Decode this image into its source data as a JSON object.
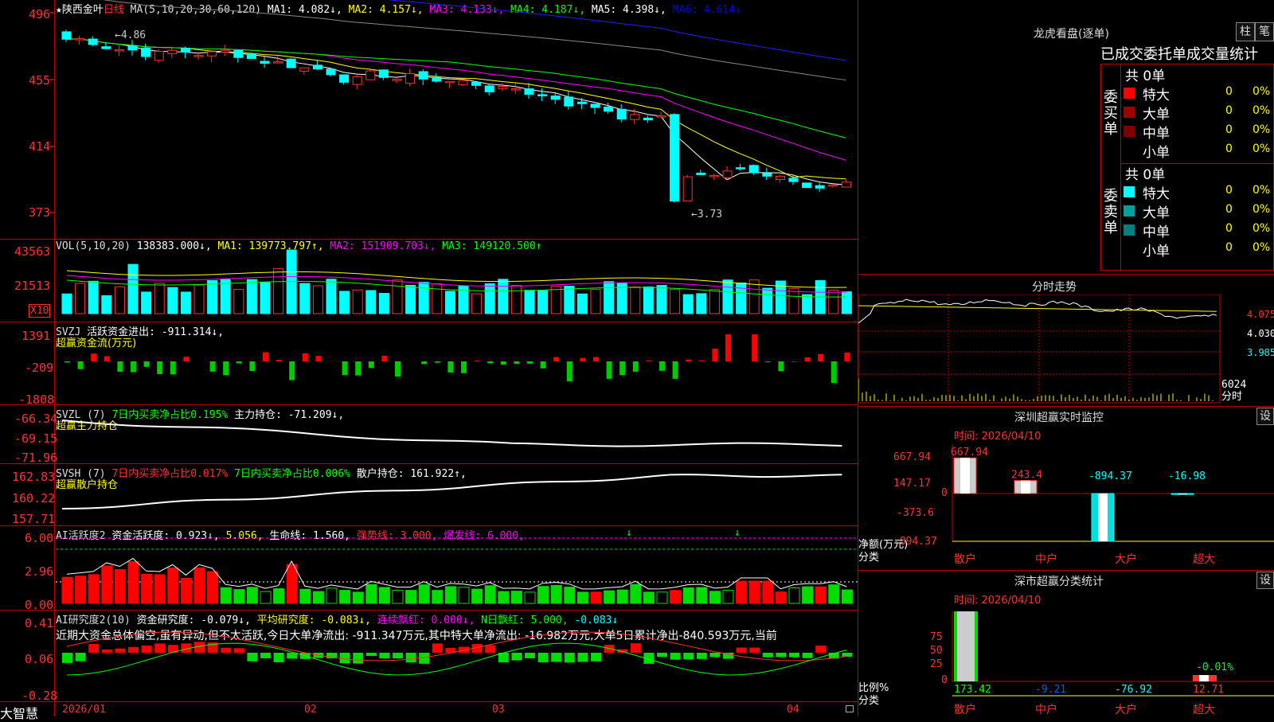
{
  "app": {
    "brand": "大智慧",
    "stock_name": "★陕西金叶",
    "period": "日线"
  },
  "main_chart": {
    "ma_text": "MA(5,10,20,30,60,120)",
    "ma1": "MA1: 4.082↓,",
    "ma2": "MA2: 4.157↓,",
    "ma3": "MA3: 4.133↓,",
    "ma4": "MA4: 4.187↓,",
    "ma5": "MA5: 4.398↓,",
    "ma6": "MA6: 4.614↓",
    "y_labels": [
      "496",
      "455",
      "414",
      "373"
    ],
    "high_marker": "←4.86",
    "low_marker": "←3.73",
    "colors": {
      "ma1": "#ffffff",
      "ma2": "#ffff00",
      "ma3": "#ff00ff",
      "ma4": "#00ff00",
      "ma5": "#ffffff",
      "ma6": "#0000ff",
      "up": "#ff3030",
      "down": "#00ffff"
    }
  },
  "vol_chart": {
    "title": "VOL(5,10,20)",
    "value": "138383.000↓,",
    "ma1": "MA1: 139773.797↑,",
    "ma2": "MA2: 151909.703↓,",
    "ma3": "MA3: 149120.500↑",
    "y_labels": [
      "43563",
      "21513"
    ],
    "unit": "X10"
  },
  "svzj": {
    "title": "SVZJ",
    "line1": "活跃资金进出: -911.314↓,",
    "line2": "超赢资金流(万元)",
    "y_labels": [
      "1391",
      "-209",
      "-1808"
    ]
  },
  "svzl": {
    "title": "SVZL (7)",
    "part1": "7日内买卖净占比0.195%",
    "part2": "主力持仓: -71.209↓,",
    "line2": "超赢主力持仓",
    "y_labels": [
      "-66.34",
      "-69.15",
      "-71.96"
    ]
  },
  "svsh": {
    "title": "SVSH (7)",
    "part1": "7日内买卖净占比0.017%",
    "part2": "7日内买卖净占比0.006%",
    "part3": "散户持仓: 161.922↑,",
    "line2": "超赢散户持仓",
    "y_labels": [
      "162.83",
      "160.22",
      "157.71"
    ]
  },
  "ai_active": {
    "title": "AI活跃度2",
    "p1": "资金活跃度: 0.923↓,",
    "p2": "5.056,",
    "p3": "生命线: 1.560,",
    "p4": "强势线: 3.000,",
    "p5": "爆发线: 6.000,",
    "y_labels": [
      "6.00",
      "2.96",
      "0.00"
    ]
  },
  "ai_research": {
    "title": "AI研究度2(10)",
    "p1": "资金研究度: -0.079↓,",
    "p2": "平均研究度: -0.083↓,",
    "p3": "连续飘红: 0.000↓,",
    "p4": "N日飘红: 5.000,",
    "p5": "-0.083↓",
    "note": "近期大资金总体偏空,虽有异动,但不太活跃,今日大单净流出: -911.347万元,其中特大单净流出: -16.982万元,大单5日累计净出-840.593万元,当前",
    "y_labels": [
      "0.41",
      "0.06",
      "-0.28"
    ]
  },
  "date_axis": [
    "2026/01",
    "02",
    "03",
    "04"
  ],
  "right_panel": {
    "dragon_title": "龙虎看盘(逐单)",
    "btn_bar": "柱",
    "btn_pen": "笔",
    "stats_title": "已成交委托单成交量统计",
    "buy": {
      "side_label": "委买单",
      "total": "共 0单",
      "rows": [
        {
          "label": "特大",
          "count": "0",
          "pct": "0%",
          "color": "#ff0000"
        },
        {
          "label": "大单",
          "count": "0",
          "pct": "0%",
          "color": "#a00000"
        },
        {
          "label": "中单",
          "count": "0",
          "pct": "0%",
          "color": "#800000"
        },
        {
          "label": "小单",
          "count": "0",
          "pct": "0%",
          "color": ""
        }
      ]
    },
    "sell": {
      "side_label": "委卖单",
      "total": "共 0单",
      "rows": [
        {
          "label": "特大",
          "count": "0",
          "pct": "0%",
          "color": "#00ffff"
        },
        {
          "label": "大单",
          "count": "0",
          "pct": "0%",
          "color": "#00a0a0"
        },
        {
          "label": "中单",
          "count": "0",
          "pct": "0%",
          "color": "#008080"
        },
        {
          "label": "小单",
          "count": "0",
          "pct": "0%",
          "color": ""
        }
      ]
    },
    "intraday_title": "分时走势",
    "intraday_labels": [
      "4.075",
      "4.030",
      "3.985",
      "6024",
      "分时"
    ],
    "sz_monitor": {
      "title": "深圳超赢实时监控",
      "btn": "设",
      "time": "时间: 2026/04/10",
      "y_labels": [
        "667.94",
        "147.17",
        "0",
        "-373.6",
        "-894.37"
      ],
      "unit": "净额(万元)",
      "cat_label": "分类",
      "categories": [
        "散户",
        "中户",
        "大户",
        "超大"
      ],
      "bar_values": [
        667.94,
        243.4,
        -894.37,
        -16.98
      ],
      "bar_labels": [
        "667.94",
        "243.4",
        "-894.37",
        "-16.98"
      ]
    },
    "sz_class": {
      "title": "深市超赢分类统计",
      "btn": "设",
      "time": "时间: 2026/04/10",
      "y_labels": [
        "75",
        "50",
        "25",
        "0"
      ],
      "unit": "比例%",
      "cat_label": "分类",
      "categories": [
        "散户",
        "中户",
        "大户",
        "超大"
      ],
      "values": [
        "173.42",
        "-9.21",
        "-76.92",
        "12.71"
      ],
      "top_label": "-0.01%"
    }
  }
}
